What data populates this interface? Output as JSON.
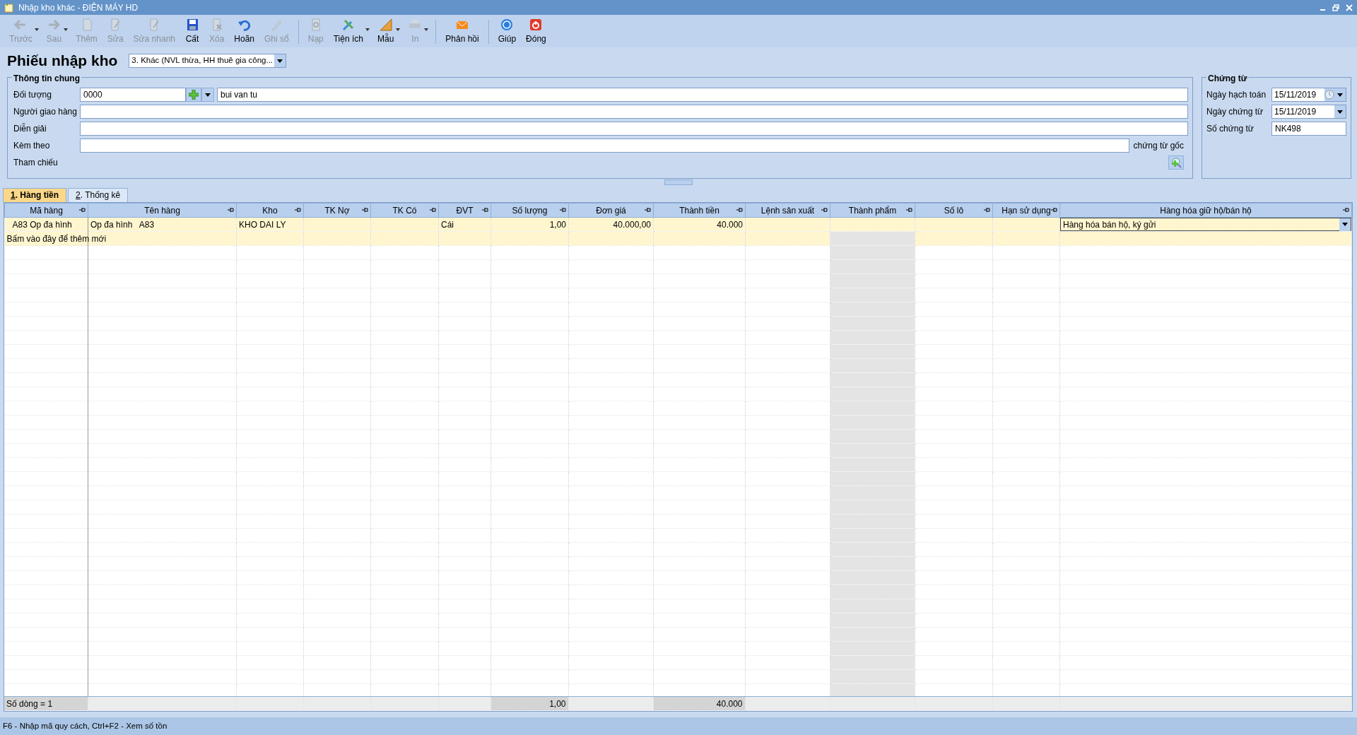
{
  "window": {
    "title": "Nhập kho khác - ĐIỆN MÁY HD"
  },
  "toolbar": [
    {
      "kind": "button",
      "label": "Trước",
      "enabled": false,
      "dropdown": true
    },
    {
      "kind": "button",
      "label": "Sau",
      "enabled": false,
      "dropdown": true
    },
    {
      "kind": "button",
      "label": "Thêm",
      "enabled": false,
      "dropdown": false
    },
    {
      "kind": "button",
      "label": "Sửa",
      "enabled": false,
      "dropdown": false
    },
    {
      "kind": "button",
      "label": "Sửa nhanh",
      "enabled": false,
      "dropdown": false
    },
    {
      "kind": "button",
      "label": "Cất",
      "enabled": true,
      "dropdown": false
    },
    {
      "kind": "button",
      "label": "Xóa",
      "enabled": false,
      "dropdown": false
    },
    {
      "kind": "button",
      "label": "Hoãn",
      "enabled": true,
      "dropdown": false
    },
    {
      "kind": "button",
      "label": "Ghi sổ",
      "enabled": false,
      "dropdown": false
    },
    {
      "kind": "separator"
    },
    {
      "kind": "button",
      "label": "Nạp",
      "enabled": false,
      "dropdown": false
    },
    {
      "kind": "button",
      "label": "Tiện ích",
      "enabled": true,
      "dropdown": true
    },
    {
      "kind": "button",
      "label": "Mẫu",
      "enabled": true,
      "dropdown": true
    },
    {
      "kind": "button",
      "label": "In",
      "enabled": false,
      "dropdown": true
    },
    {
      "kind": "separator"
    },
    {
      "kind": "button",
      "label": "Phản hồi",
      "enabled": true,
      "dropdown": false
    },
    {
      "kind": "separator"
    },
    {
      "kind": "button",
      "label": "Giúp",
      "enabled": true,
      "dropdown": false
    },
    {
      "kind": "button",
      "label": "Đóng",
      "enabled": true,
      "dropdown": false
    }
  ],
  "header": {
    "title": "Phiếu nhập kho",
    "voucher_type": "3. Khác (NVL thừa, HH thuê gia công..."
  },
  "general": {
    "legend": "Thông tin chung",
    "object": {
      "label": "Đối tượng",
      "code": "0000",
      "name": "bui van tu"
    },
    "deliverer": {
      "label": "Người giao hàng"
    },
    "description": {
      "label": "Diễn giải"
    },
    "attached": {
      "label": "Kèm theo",
      "suffix": "chứng từ gốc"
    },
    "reference": {
      "label": "Tham chiếu"
    }
  },
  "voucher": {
    "legend": "Chứng từ",
    "fields": [
      {
        "kind": "date_clock",
        "label": "Ngày hạch toán",
        "value": "15/11/2019"
      },
      {
        "kind": "date",
        "label": "Ngày chứng từ",
        "value": "15/11/2019"
      },
      {
        "kind": "text",
        "label": "Số chứng từ",
        "value": "NK498"
      }
    ]
  },
  "tabs": [
    {
      "label": "1. Hàng tiền",
      "selected": true
    },
    {
      "label": "2. Thống kê",
      "selected": false
    }
  ],
  "table": {
    "columns": [
      {
        "label": "Mã hàng",
        "kind": "text",
        "readonly": false
      },
      {
        "label": "Tên hàng",
        "kind": "text",
        "readonly": false
      },
      {
        "label": "Kho",
        "kind": "text",
        "readonly": false
      },
      {
        "label": "TK Nợ",
        "kind": "text",
        "readonly": false
      },
      {
        "label": "TK Có",
        "kind": "text",
        "readonly": false
      },
      {
        "label": "ĐVT",
        "kind": "text",
        "readonly": false
      },
      {
        "label": "Số lượng",
        "kind": "number",
        "readonly": false
      },
      {
        "label": "Đơn giá",
        "kind": "number",
        "readonly": false
      },
      {
        "label": "Thành tiền",
        "kind": "number",
        "readonly": false
      },
      {
        "label": "Lệnh sản xuất",
        "kind": "text",
        "readonly": false
      },
      {
        "label": "Thành phẩm",
        "kind": "text",
        "readonly": true
      },
      {
        "label": "Số lô",
        "kind": "text",
        "readonly": false
      },
      {
        "label": "Hạn sử dụng",
        "kind": "text",
        "readonly": false
      },
      {
        "label": "Hàng hóa giữ hộ/bán hộ",
        "kind": "dropdown",
        "readonly": false
      }
    ],
    "rows": [
      {
        "cells": [
          "A83 Op đa hình",
          "Op đa hình   A83",
          "KHO DAI LY",
          "",
          "",
          "Cái",
          "1,00",
          "40.000,00",
          "40.000",
          "",
          "",
          "",
          "",
          "Hàng hóa bán hộ, ký gửi"
        ]
      }
    ],
    "new_row_hint": "Bấm vào đây để thêm mới",
    "footer": {
      "count": "Số dòng = 1",
      "quantity": "1,00",
      "amount": "40.000"
    }
  },
  "status_bar": "F6 - Nhập mã quy cách, Ctrl+F2 - Xem số tồn"
}
